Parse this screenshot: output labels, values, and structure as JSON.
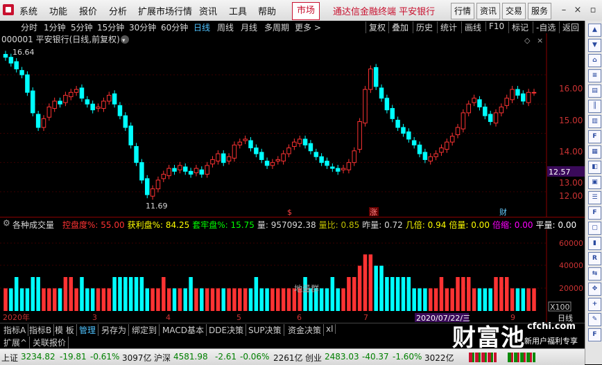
{
  "menu": {
    "items": [
      "系统",
      "功能",
      "报价",
      "分析",
      "扩展市场行情",
      "资讯",
      "工具",
      "帮助"
    ],
    "market_tab": "市场",
    "broker_title": "通达信金融终端  平安银行",
    "right_buttons": [
      "行情",
      "资讯",
      "交易",
      "服务"
    ]
  },
  "periods": {
    "items": [
      "分时",
      "1分钟",
      "5分钟",
      "15分钟",
      "30分钟",
      "60分钟",
      "日线",
      "周线",
      "月线",
      "多周期",
      "更多 >"
    ],
    "active": "日线",
    "right_items": [
      "复权",
      "叠加",
      "历史",
      "统计",
      "画线",
      "F10",
      "标记",
      "-自选",
      "返回"
    ]
  },
  "chart_header": {
    "title": "000001 平安银行(日线,前复权)",
    "price_labels": [
      "16.00",
      "15.00",
      "14.00",
      "13.00",
      "12.00"
    ],
    "current_price": "12.57",
    "high_label": "16.64",
    "low_label": "11.69",
    "markers": [
      "$",
      "涨",
      "财"
    ]
  },
  "volume_header": {
    "title": "各种成交量",
    "indicators": [
      {
        "label": "控盘度%:",
        "value": "55.00",
        "color": "#ff3333"
      },
      {
        "label": "获利盘%:",
        "value": "84.25",
        "color": "#ffff00"
      },
      {
        "label": "套牢盘%:",
        "value": "15.75",
        "color": "#00ff00"
      },
      {
        "label": "量:",
        "value": "957092.38",
        "color": "#d8d8d8"
      },
      {
        "label": "量比:",
        "value": "0.85",
        "color": "#c0c000"
      },
      {
        "label": "昨量:",
        "value": "0.72",
        "color": "#d8d8d8"
      },
      {
        "label": "几倍:",
        "value": "0.94",
        "color": "#ffff00"
      },
      {
        "label": "倍量:",
        "value": "0.00",
        "color": "#ffff00"
      },
      {
        "label": "倍缩:",
        "value": "0.00",
        "color": "#ff00ff"
      },
      {
        "label": "平量:",
        "value": "0.00",
        "color": "#ffffff"
      }
    ],
    "volume_axis": [
      "60000",
      "40000",
      "20000"
    ],
    "unit": "X100",
    "ground_label": "地量群",
    "year_label": "2020年",
    "month_labels": [
      "3",
      "4",
      "5",
      "6",
      "7",
      "9"
    ],
    "date_tag": "2020/07/22/三",
    "period_label": "日线"
  },
  "chart_data": [
    {
      "type": "candlestick",
      "ylim": [
        11.5,
        16.9
      ],
      "x_months": [
        "2020-01",
        "2020-03",
        "2020-04",
        "2020-05",
        "2020-06",
        "2020-07",
        "2020-09"
      ],
      "close": [
        16.6,
        16.4,
        16.2,
        16.0,
        15.4,
        14.7,
        14.2,
        14.5,
        14.9,
        15.1,
        15.0,
        15.3,
        15.4,
        15.5,
        15.2,
        15.0,
        14.8,
        14.9,
        15.1,
        15.3,
        15.0,
        14.6,
        14.2,
        13.6,
        13.0,
        12.4,
        11.9,
        12.1,
        12.4,
        12.6,
        12.8,
        12.7,
        12.9,
        12.7,
        12.6,
        12.8,
        12.6,
        12.9,
        13.1,
        13.3,
        13.0,
        13.2,
        13.6,
        13.7,
        13.8,
        13.5,
        13.3,
        13.1,
        12.9,
        13.0,
        13.1,
        13.3,
        13.5,
        13.7,
        13.8,
        13.6,
        13.4,
        13.2,
        13.0,
        12.9,
        12.8,
        12.7,
        12.8,
        13.0,
        13.4,
        14.4,
        15.5,
        16.2,
        15.6,
        15.2,
        14.8,
        14.5,
        14.2,
        14.0,
        13.8,
        13.6,
        13.3,
        13.1,
        13.2,
        13.3,
        13.5,
        13.7,
        13.9,
        14.2,
        14.7,
        15.0,
        15.2,
        14.9,
        14.6,
        14.4,
        14.7,
        14.9,
        15.2,
        15.5,
        15.3,
        15.1,
        15.4,
        15.4
      ],
      "volume": [
        2,
        2,
        3,
        2,
        2,
        3,
        3,
        2,
        2,
        2,
        2,
        3,
        3,
        2,
        3,
        2,
        2,
        2,
        2,
        2,
        3,
        3,
        3,
        3,
        3,
        3,
        2,
        2,
        2,
        3,
        2,
        2,
        2,
        2,
        3,
        2,
        2,
        2,
        2,
        2,
        2,
        2,
        2,
        2,
        2,
        2,
        3,
        2,
        2,
        2,
        2,
        2,
        2,
        2,
        2,
        3,
        2,
        2,
        2,
        2,
        3,
        2,
        2,
        3,
        3,
        4,
        5,
        5,
        4,
        4,
        3,
        3,
        3,
        3,
        3,
        2,
        2,
        2,
        2,
        2,
        3,
        2,
        2,
        3,
        3,
        3,
        2,
        2,
        2,
        2,
        3,
        3,
        3,
        2,
        2,
        2,
        2,
        2
      ]
    }
  ],
  "bottom_tabs": {
    "row1": [
      "指标A",
      "指标B",
      "模 板",
      "管理",
      "另存为",
      "绑定到",
      "MACD基本",
      "DDE决策",
      "SUP决策",
      "资金决策",
      "xl"
    ],
    "row1_active": "管理",
    "row2": [
      "扩展^",
      "关联报价"
    ]
  },
  "status": {
    "items": [
      {
        "name": "上证",
        "price": "3234.82",
        "chg": "-19.81",
        "pct": "-0.61%",
        "amt": "3097亿"
      },
      {
        "name": "沪深",
        "price": "4581.98",
        "chg": "-2.61",
        "pct": "-0.06%",
        "amt": "2261亿"
      },
      {
        "name": "创业",
        "price": "2483.03",
        "chg": "-40.37",
        "pct": "-1.60%",
        "amt": "3022亿"
      }
    ]
  },
  "watermark": {
    "logo": "财富池",
    "site": "cfchi.com",
    "sub": "新用户福利专享"
  },
  "colors": {
    "up": "#ff3333",
    "down": "#00ffff",
    "accent": "#c8102e"
  }
}
